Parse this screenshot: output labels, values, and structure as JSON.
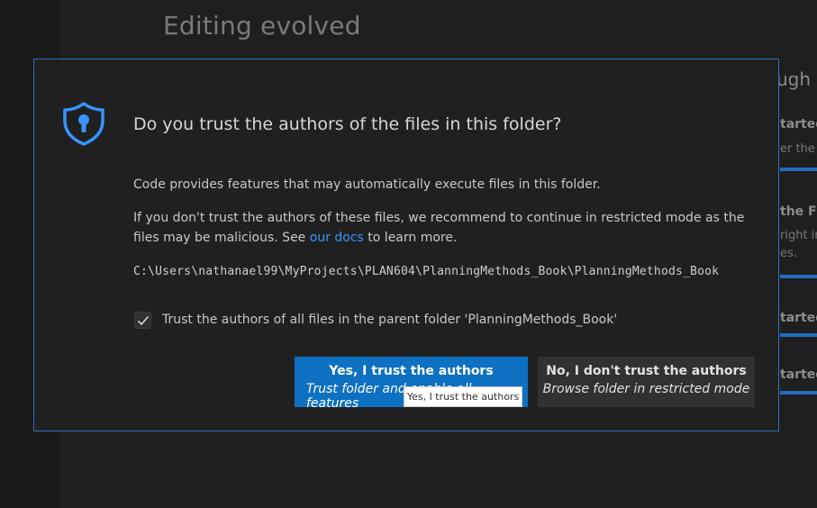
{
  "background": {
    "title": "Editing evolved",
    "walkthroughs_heading": "ugh",
    "cards": [
      {
        "title": "tarted",
        "subtitle": "er the"
      },
      {
        "title": "the F",
        "subtitle": "right in"
      },
      {
        "title": "",
        "subtitle": "es."
      },
      {
        "title": "tarted",
        "subtitle": ""
      },
      {
        "title": "tarted",
        "subtitle": ""
      }
    ]
  },
  "dialog": {
    "icon": "shield-lock-icon",
    "title": "Do you trust the authors of the files in this folder?",
    "para1": "Code provides features that may automatically execute files in this folder.",
    "para2_before": "If you don't trust the authors of these files, we recommend to continue in restricted mode as the files may be malicious. See ",
    "para2_link": "our docs",
    "para2_after": " to learn more.",
    "path": "C:\\Users\\nathanael99\\MyProjects\\PLAN604\\PlanningMethods_Book\\PlanningMethods_Book",
    "checkbox_checked": true,
    "checkbox_label": "Trust the authors of all files in the parent folder 'PlanningMethods_Book'",
    "primary_button": {
      "title": "Yes, I trust the authors",
      "subtitle": "Trust folder and enable all features"
    },
    "secondary_button": {
      "title": "No, I don't trust the authors",
      "subtitle": "Browse folder in restricted mode"
    },
    "tooltip": "Yes, I trust the authors"
  },
  "colors": {
    "accent": "#0e70c0",
    "link": "#3794ff",
    "border": "#2f6fbf"
  }
}
